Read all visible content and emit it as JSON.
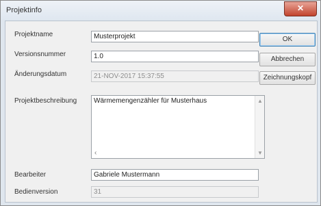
{
  "window": {
    "title": "Projektinfo",
    "close_glyph": "✕"
  },
  "form": {
    "projektname": {
      "label": "Projektname",
      "value": "Musterprojekt"
    },
    "versionsnummer": {
      "label": "Versionsnummer",
      "value": "1.0"
    },
    "aenderungsdatum": {
      "label": "Änderungsdatum",
      "value": "21-NOV-2017 15:37:55"
    },
    "projektbeschreibung": {
      "label": "Projektbeschreibung",
      "value": "Wärmemengenzähler für Musterhaus"
    },
    "bearbeiter": {
      "label": "Bearbeiter",
      "value": "Gabriele Mustermann"
    },
    "bedienversion": {
      "label": "Bedienversion",
      "value": "31"
    }
  },
  "buttons": {
    "ok": "OK",
    "abbrechen": "Abbrechen",
    "zeichnungskopf": "Zeichnungskopf"
  },
  "icons": {
    "scroll_up": "scroll-up-arrow-icon",
    "scroll_down": "scroll-down-arrow-icon"
  }
}
